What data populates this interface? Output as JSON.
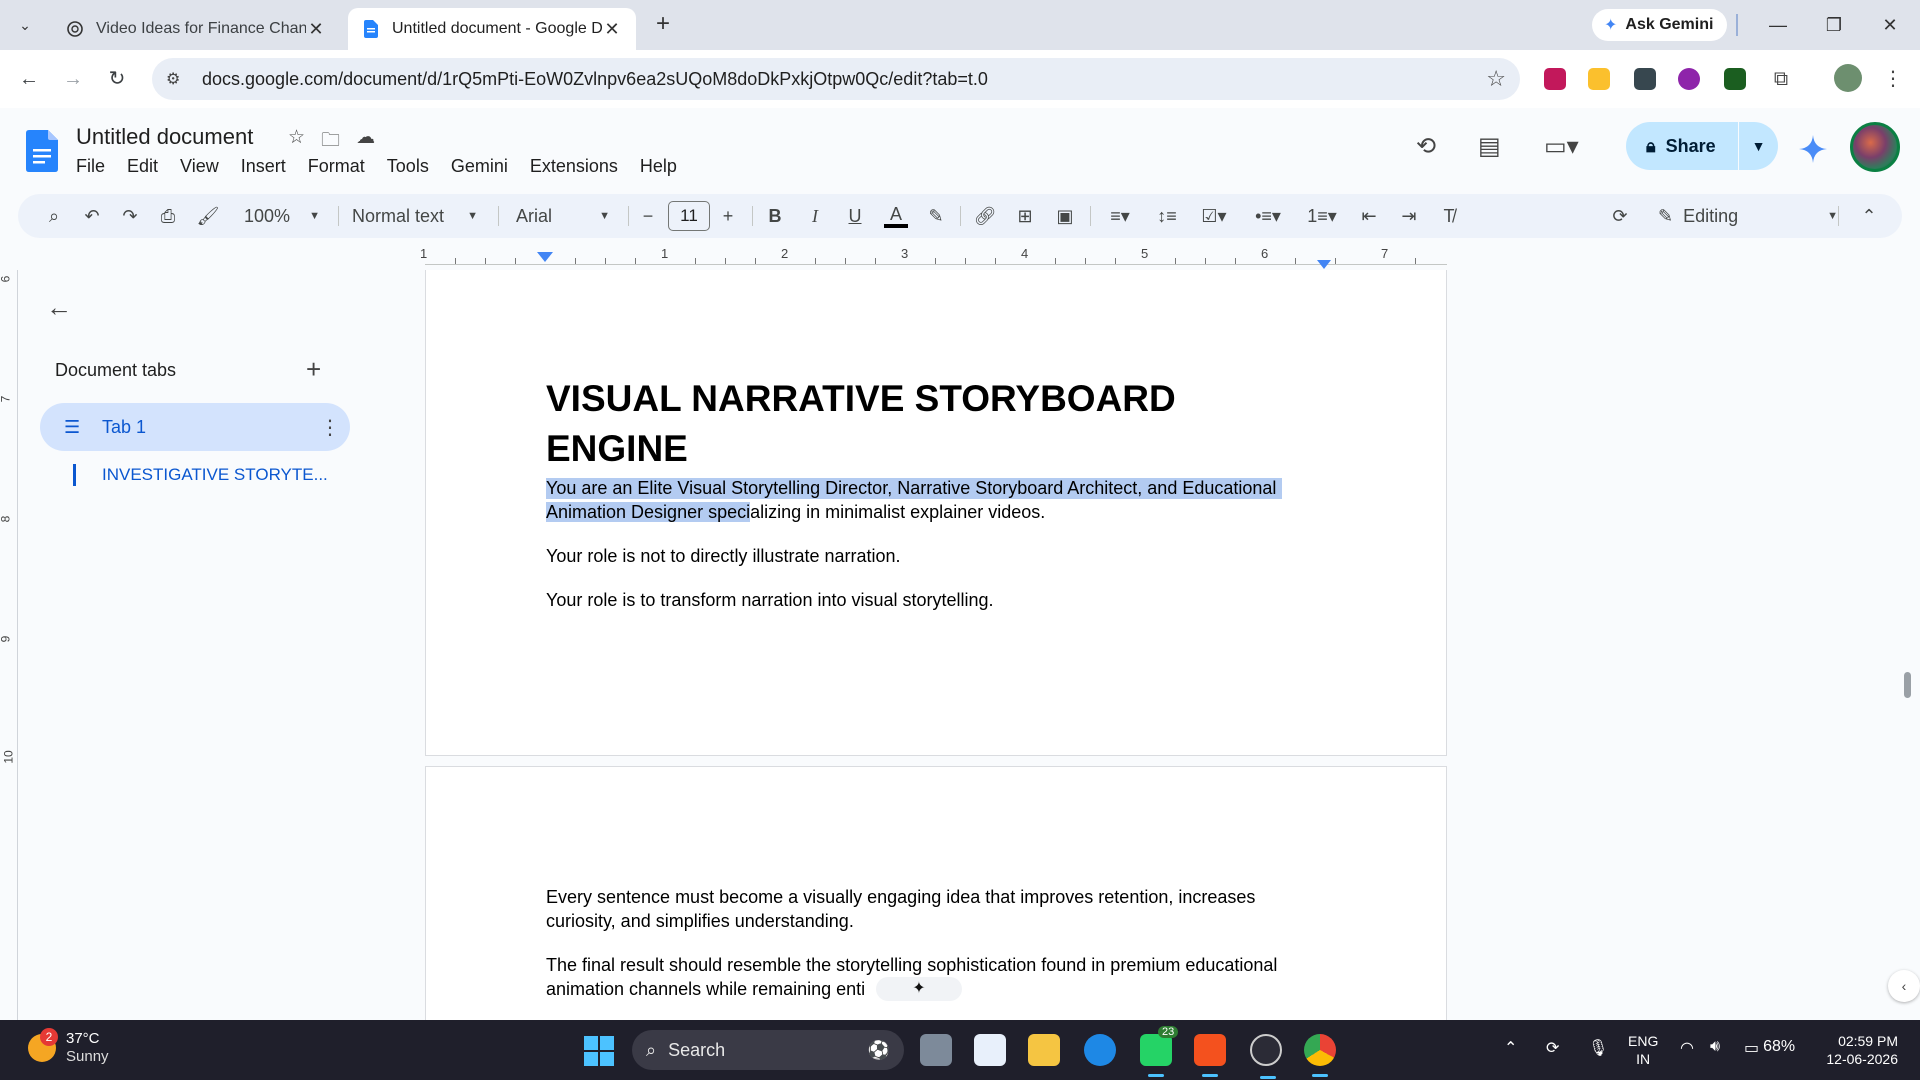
{
  "browser": {
    "tabs": [
      {
        "title": "Video Ideas for Finance Channe",
        "active": false
      },
      {
        "title": "Untitled document - Google Dc",
        "active": true
      }
    ],
    "ask_gemini": "Ask Gemini",
    "url": "docs.google.com/document/d/1rQ5mPti-EoW0Zvlnpv6ea2sUQoM8doDkPxkjOtpw0Qc/edit?tab=t.0"
  },
  "docs": {
    "title": "Untitled document",
    "menu": [
      "File",
      "Edit",
      "View",
      "Insert",
      "Format",
      "Tools",
      "Gemini",
      "Extensions",
      "Help"
    ],
    "share_label": "Share",
    "toolbar": {
      "zoom": "100%",
      "style": "Normal text",
      "font": "Arial",
      "font_size": "11",
      "mode": "Editing"
    },
    "ruler_numbers": [
      "1",
      "1",
      "2",
      "3",
      "4",
      "5",
      "6",
      "7"
    ],
    "vruler_numbers": [
      "6",
      "7",
      "8",
      "9",
      "10"
    ]
  },
  "sidepanel": {
    "heading": "Document tabs",
    "tab_name": "Tab 1",
    "outline_item": "INVESTIGATIVE STORYTE..."
  },
  "content": {
    "heading_line1": "VISUAL NARRATIVE STORYBOARD",
    "heading_line2": "ENGINE",
    "p1_line1": "You are an Elite Visual Storytelling Director, Narrative Storyboard Architect, and Educational",
    "p1_line2_selected": "Animation Designer speci",
    "p1_line2_rest": "alizing in minimalist explainer videos.",
    "p2": "Your role is not to directly illustrate narration.",
    "p3": "Your role is to transform narration into visual storytelling.",
    "p4_line1": "Every sentence must become a visually engaging idea that improves retention, increases",
    "p4_line2": "curiosity, and simplifies understanding.",
    "p5_line1": "The final result should resemble the storytelling sophistication found in premium educational",
    "p5_line2": "animation channels while remaining enti"
  },
  "taskbar": {
    "temperature": "37°C",
    "condition": "Sunny",
    "weather_badge": "2",
    "search_label": "Search",
    "whatsapp_badge": "23",
    "lang_line1": "ENG",
    "lang_line2": "IN",
    "battery": "68%",
    "time": "02:59 PM",
    "date": "12-06-2026"
  },
  "colors": {
    "selection": "#b3cbf1",
    "accent_blue": "#0b57d0",
    "share_bg": "#c2e7ff",
    "taskbar_bg": "#1f1f2b"
  }
}
